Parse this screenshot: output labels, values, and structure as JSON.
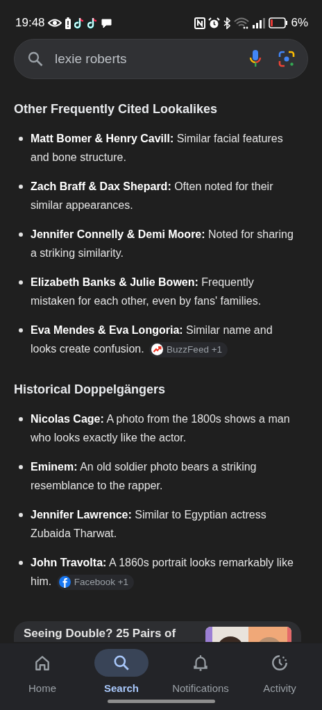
{
  "status_bar": {
    "time": "19:48",
    "battery_text": "6%"
  },
  "search": {
    "value": "lexie roberts"
  },
  "sections": [
    {
      "title": "Other Frequently Cited Lookalikes",
      "items": [
        {
          "name": "Matt Bomer & Henry Cavill:",
          "text": "Similar facial features and bone structure."
        },
        {
          "name": "Zach Braff & Dax Shepard:",
          "text": "Often noted for their similar appearances."
        },
        {
          "name": "Jennifer Connelly & Demi Moore:",
          "text": "Noted for sharing a striking similarity."
        },
        {
          "name": "Elizabeth Banks & Julie Bowen:",
          "text": "Frequently mistaken for each other, even by fans' families."
        },
        {
          "name": "Eva Mendes & Eva Longoria:",
          "text": "Similar name and looks create confusion.",
          "source": {
            "kind": "trend",
            "label": "BuzzFeed +1"
          }
        }
      ]
    },
    {
      "title": "Historical Doppelgängers",
      "items": [
        {
          "name": "Nicolas Cage:",
          "text": "A photo from the 1800s shows a man who looks exactly like the actor."
        },
        {
          "name": "Eminem:",
          "text": "An old soldier photo bears a striking resemblance to the rapper."
        },
        {
          "name": "Jennifer Lawrence:",
          "text": "Similar to Egyptian actress Zubaida Tharwat."
        },
        {
          "name": "John Travolta:",
          "text": "A 1860s portrait looks remarkably like him.",
          "source": {
            "kind": "facebook",
            "label": "Facebook +1"
          }
        }
      ]
    }
  ],
  "card": {
    "title": "Seeing Double? 25 Pairs of",
    "kind": "picture"
  },
  "nav": [
    {
      "kind": "home",
      "label": "Home",
      "selected": false
    },
    {
      "kind": "search",
      "label": "Search",
      "selected": true
    },
    {
      "kind": "bell",
      "label": "Notifications",
      "selected": false
    },
    {
      "kind": "activity",
      "label": "Activity",
      "selected": false
    }
  ]
}
